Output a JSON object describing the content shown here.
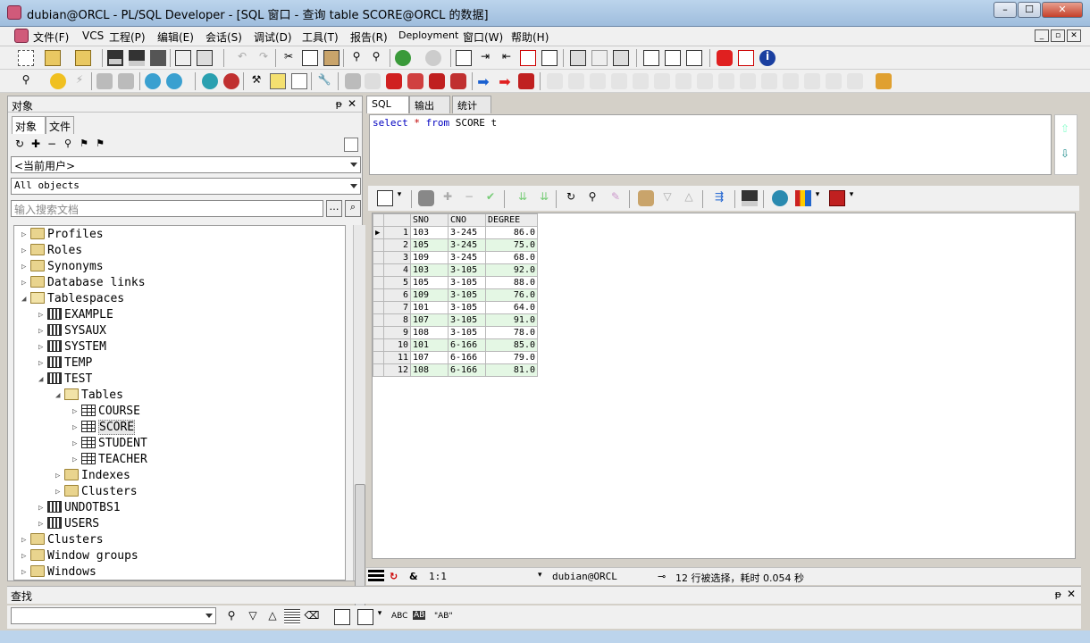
{
  "window": {
    "title": "dubian@ORCL - PL/SQL Developer - [SQL 窗口 - 查询 table SCORE@ORCL 的数据]",
    "min": "–",
    "max": "☐",
    "close": "✕"
  },
  "menu": [
    "文件(F)",
    "VCS",
    "工程(P)",
    "编辑(E)",
    "会话(S)",
    "调试(D)",
    "工具(T)",
    "报告(R)",
    "Deployment",
    "窗口(W)",
    "帮助(H)"
  ],
  "objects_panel": {
    "title": "对象",
    "tabs": [
      "对象",
      "文件"
    ],
    "user_combo": "<当前用户>",
    "type_combo": "All objects",
    "search_placeholder": "输入搜索文档"
  },
  "tree": [
    {
      "label": "Profiles",
      "level": 0,
      "type": "folder",
      "exp": "▷"
    },
    {
      "label": "Roles",
      "level": 0,
      "type": "folder",
      "exp": "▷"
    },
    {
      "label": "Synonyms",
      "level": 0,
      "type": "folder",
      "exp": "▷"
    },
    {
      "label": "Database links",
      "level": 0,
      "type": "folder",
      "exp": "▷"
    },
    {
      "label": "Tablespaces",
      "level": 0,
      "type": "folderopen",
      "exp": "◢"
    },
    {
      "label": "EXAMPLE",
      "level": 1,
      "type": "ts",
      "exp": "▷"
    },
    {
      "label": "SYSAUX",
      "level": 1,
      "type": "ts",
      "exp": "▷"
    },
    {
      "label": "SYSTEM",
      "level": 1,
      "type": "ts",
      "exp": "▷"
    },
    {
      "label": "TEMP",
      "level": 1,
      "type": "ts",
      "exp": "▷"
    },
    {
      "label": "TEST",
      "level": 1,
      "type": "ts",
      "exp": "◢"
    },
    {
      "label": "Tables",
      "level": 2,
      "type": "folderopen",
      "exp": "◢"
    },
    {
      "label": "COURSE",
      "level": 3,
      "type": "table",
      "exp": "▷"
    },
    {
      "label": "SCORE",
      "level": 3,
      "type": "table",
      "exp": "▷",
      "selected": true
    },
    {
      "label": "STUDENT",
      "level": 3,
      "type": "table",
      "exp": "▷"
    },
    {
      "label": "TEACHER",
      "level": 3,
      "type": "table",
      "exp": "▷"
    },
    {
      "label": "Indexes",
      "level": 2,
      "type": "folder",
      "exp": "▷"
    },
    {
      "label": "Clusters",
      "level": 2,
      "type": "folder",
      "exp": "▷"
    },
    {
      "label": "UNDOTBS1",
      "level": 1,
      "type": "ts",
      "exp": "▷"
    },
    {
      "label": "USERS",
      "level": 1,
      "type": "ts",
      "exp": "▷"
    },
    {
      "label": "Clusters",
      "level": 0,
      "type": "folder",
      "exp": "▷"
    },
    {
      "label": "Window groups",
      "level": 0,
      "type": "folder",
      "exp": "▷"
    },
    {
      "label": "Windows",
      "level": 0,
      "type": "folder",
      "exp": "▷"
    }
  ],
  "sql_tabs": [
    "SQL",
    "输出",
    "统计"
  ],
  "sql": {
    "kw1": "select",
    "op": "*",
    "kw2": "from",
    "rest": "SCORE t"
  },
  "grid": {
    "columns": [
      "SNO",
      "CNO",
      "DEGREE"
    ],
    "rows": [
      [
        "103",
        "3-245",
        "86.0"
      ],
      [
        "105",
        "3-245",
        "75.0"
      ],
      [
        "109",
        "3-245",
        "68.0"
      ],
      [
        "103",
        "3-105",
        "92.0"
      ],
      [
        "105",
        "3-105",
        "88.0"
      ],
      [
        "109",
        "3-105",
        "76.0"
      ],
      [
        "101",
        "3-105",
        "64.0"
      ],
      [
        "107",
        "3-105",
        "91.0"
      ],
      [
        "108",
        "3-105",
        "78.0"
      ],
      [
        "101",
        "6-166",
        "85.0"
      ],
      [
        "107",
        "6-166",
        "79.0"
      ],
      [
        "108",
        "6-166",
        "81.0"
      ]
    ]
  },
  "status": {
    "position": "1:1",
    "connection": "dubian@ORCL",
    "message": "12 行被选择，耗时 0.054 秒"
  },
  "find": {
    "title": "查找",
    "abc1": "ABC",
    "abc2": "AB",
    "abc3": "\"AB\""
  }
}
